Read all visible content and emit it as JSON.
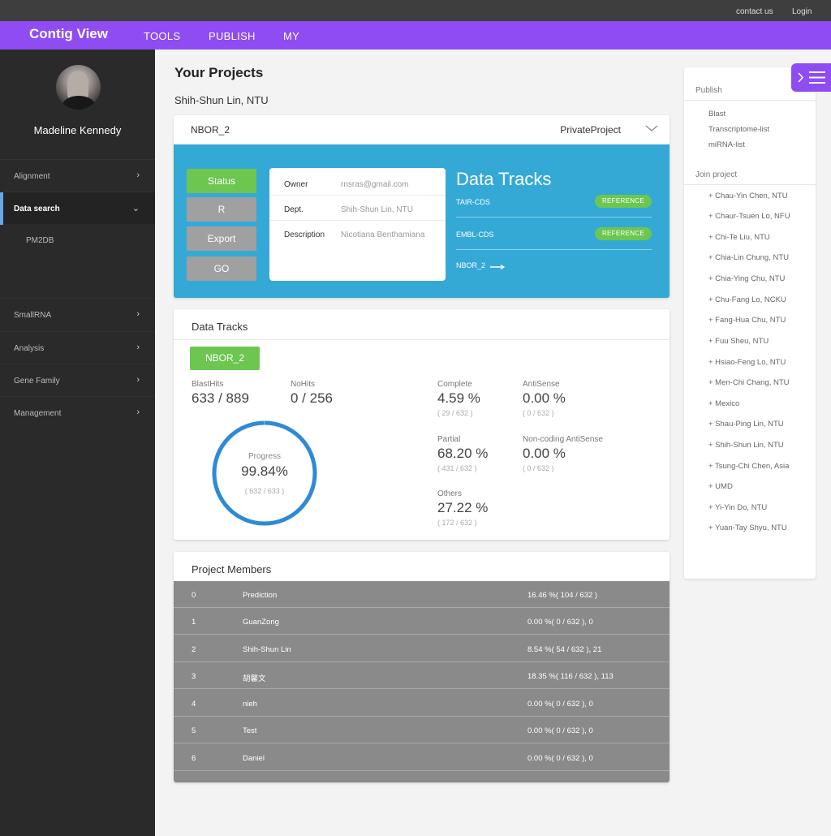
{
  "topbar": {
    "contact": "contact us",
    "login": "Login"
  },
  "nav": {
    "brand": "Contig View",
    "items": [
      "TOOLS",
      "PUBLISH",
      "MY"
    ]
  },
  "sidebar": {
    "username": "Madeline Kennedy",
    "items": [
      {
        "label": "Alignment",
        "chevron": "›"
      },
      {
        "label": "Data search",
        "chevron": "⌄"
      },
      {
        "label": "SmallRNA",
        "chevron": "›"
      },
      {
        "label": "Analysis",
        "chevron": "›"
      },
      {
        "label": "Gene Family",
        "chevron": "›"
      },
      {
        "label": "Management",
        "chevron": "›"
      }
    ],
    "subitem": "PM2DB"
  },
  "main": {
    "title": "Your Projects",
    "subtitle": "Shih-Shun Lin, NTU",
    "project": {
      "name": "NBOR_2",
      "type": "PrivateProject",
      "buttons": [
        "Status",
        "R",
        "Export",
        "GO"
      ],
      "info": [
        {
          "key": "Owner",
          "value": "rnsras@gmail.com"
        },
        {
          "key": "Dept.",
          "value": "Shih-Shun Lin, NTU"
        },
        {
          "key": "Description",
          "value": "Nicotiana Benthamiana"
        }
      ],
      "data_tracks_title": "Data Tracks",
      "tracks": [
        {
          "name": "TAIR-CDS",
          "badge": "REFERENCE"
        },
        {
          "name": "EMBL-CDS",
          "badge": "REFERENCE"
        }
      ],
      "track_link": "NBOR_2"
    },
    "data_tracks_card": {
      "title": "Data Tracks",
      "button": "NBOR_2",
      "blasthits": {
        "label": "BlastHits",
        "value": "633 / 889"
      },
      "nohits": {
        "label": "NoHits",
        "value": "0 / 256"
      },
      "progress": {
        "label": "Progress",
        "value": "99.84%",
        "fraction": "( 632 / 633 )",
        "ratio": 0.9984
      },
      "stats": [
        {
          "label": "Complete",
          "value": "4.59 %",
          "fraction": "( 29 / 632 )"
        },
        {
          "label": "AntiSense",
          "value": "0.00 %",
          "fraction": "( 0 / 632 )"
        },
        {
          "label": "Partial",
          "value": "68.20 %",
          "fraction": "( 431 / 632 )"
        },
        {
          "label": "Non-coding AntiSense",
          "value": "0.00 %",
          "fraction": "( 0 / 632 )"
        },
        {
          "label": "Others",
          "value": "27.22 %",
          "fraction": "( 172 / 632 )"
        }
      ]
    },
    "members": {
      "title": "Project Members",
      "rows": [
        {
          "idx": "0",
          "name": "Prediction",
          "value": "16.46 %( 104 / 632 )"
        },
        {
          "idx": "1",
          "name": "GuanZong",
          "value": "0.00 %( 0 / 632 ), 0"
        },
        {
          "idx": "2",
          "name": "Shih-Shun Lin",
          "value": "8.54 %( 54 / 632 ), 21"
        },
        {
          "idx": "3",
          "name": "胡馨文",
          "value": "18.35 %( 116 / 632 ), 113"
        },
        {
          "idx": "4",
          "name": "nieh",
          "value": "0.00 %( 0 / 632 ), 0"
        },
        {
          "idx": "5",
          "name": "Test",
          "value": "0.00 %( 0 / 632 ), 0"
        },
        {
          "idx": "6",
          "name": "Daniel",
          "value": "0.00 %( 0 / 632 ), 0"
        }
      ]
    }
  },
  "right_panel": {
    "publish_header": "Publish",
    "publish_items": [
      "Blast",
      "Transcriptome-list",
      "miRNA-list"
    ],
    "join_header": "Join project",
    "join_items": [
      "+ Chau-Yin Chen, NTU",
      "+ Chaur-Tsuen Lo, NFU",
      "+ Chi-Te Liu, NTU",
      "+ Chia-Lin Chung, NTU",
      "+ Chia-Ying Chu, NTU",
      "+ Chu-Fang Lo, NCKU",
      "+ Fang-Hua Chu, NTU",
      "+ Fuu Sheu, NTU",
      "+ Hsiao-Feng Lo, NTU",
      "+ Men-Chi Chang, NTU",
      "+ Mexico",
      "+ Shau-Ping Lin, NTU",
      "+ Shih-Shun Lin, NTU",
      "+ Tsung-Chi Chen, Asia",
      "+ UMD",
      "+ Yi-Yin Do, NTU",
      "+ Yuan-Tay Shyu, NTU"
    ]
  },
  "colors": {
    "accent": "#8e4cf2",
    "panel_blue": "#35a9d6",
    "green": "#6cc64f",
    "progress_blue": "#2f8ad6"
  }
}
